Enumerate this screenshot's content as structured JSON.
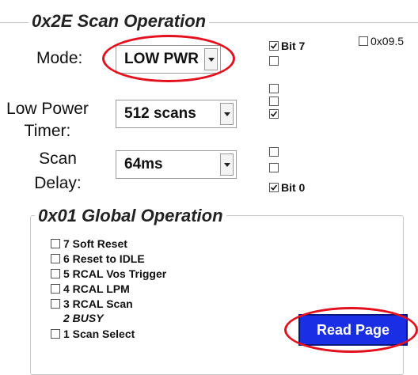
{
  "scan_operation": {
    "title": "0x2E Scan Operation",
    "mode": {
      "label": "Mode:",
      "value": "LOW PWR"
    },
    "low_power_timer": {
      "label_line1": "Low Power",
      "label_line2": "Timer:",
      "value": "512 scans"
    },
    "scan_delay": {
      "label_line1": "Scan",
      "label_line2": "Delay:",
      "value": "64ms"
    },
    "bits": [
      {
        "label": "Bit 7",
        "checked": true
      },
      {
        "label": "",
        "checked": false
      },
      {
        "label": "",
        "checked": false
      },
      {
        "label": "",
        "checked": false
      },
      {
        "label": "",
        "checked": true
      },
      {
        "label": "",
        "checked": false
      },
      {
        "label": "",
        "checked": false
      },
      {
        "label": "Bit 0",
        "checked": true
      }
    ],
    "extra_checkbox": {
      "label": "0x09.5",
      "checked": false
    }
  },
  "global_operation": {
    "title": "0x01 Global Operation",
    "items": [
      {
        "label": "7 Soft Reset",
        "checked": false
      },
      {
        "label": "6 Reset to IDLE",
        "checked": false
      },
      {
        "label": "5 RCAL Vos Trigger",
        "checked": false
      },
      {
        "label": "4 RCAL LPM",
        "checked": false
      },
      {
        "label": "3 RCAL Scan",
        "checked": false
      },
      {
        "label": "1 Scan Select",
        "checked": false
      }
    ],
    "busy_label": "2 BUSY"
  },
  "read_page_button": {
    "label": "Read Page"
  },
  "colors": {
    "highlight": "#e3101e",
    "button": "#1a2ee6"
  }
}
